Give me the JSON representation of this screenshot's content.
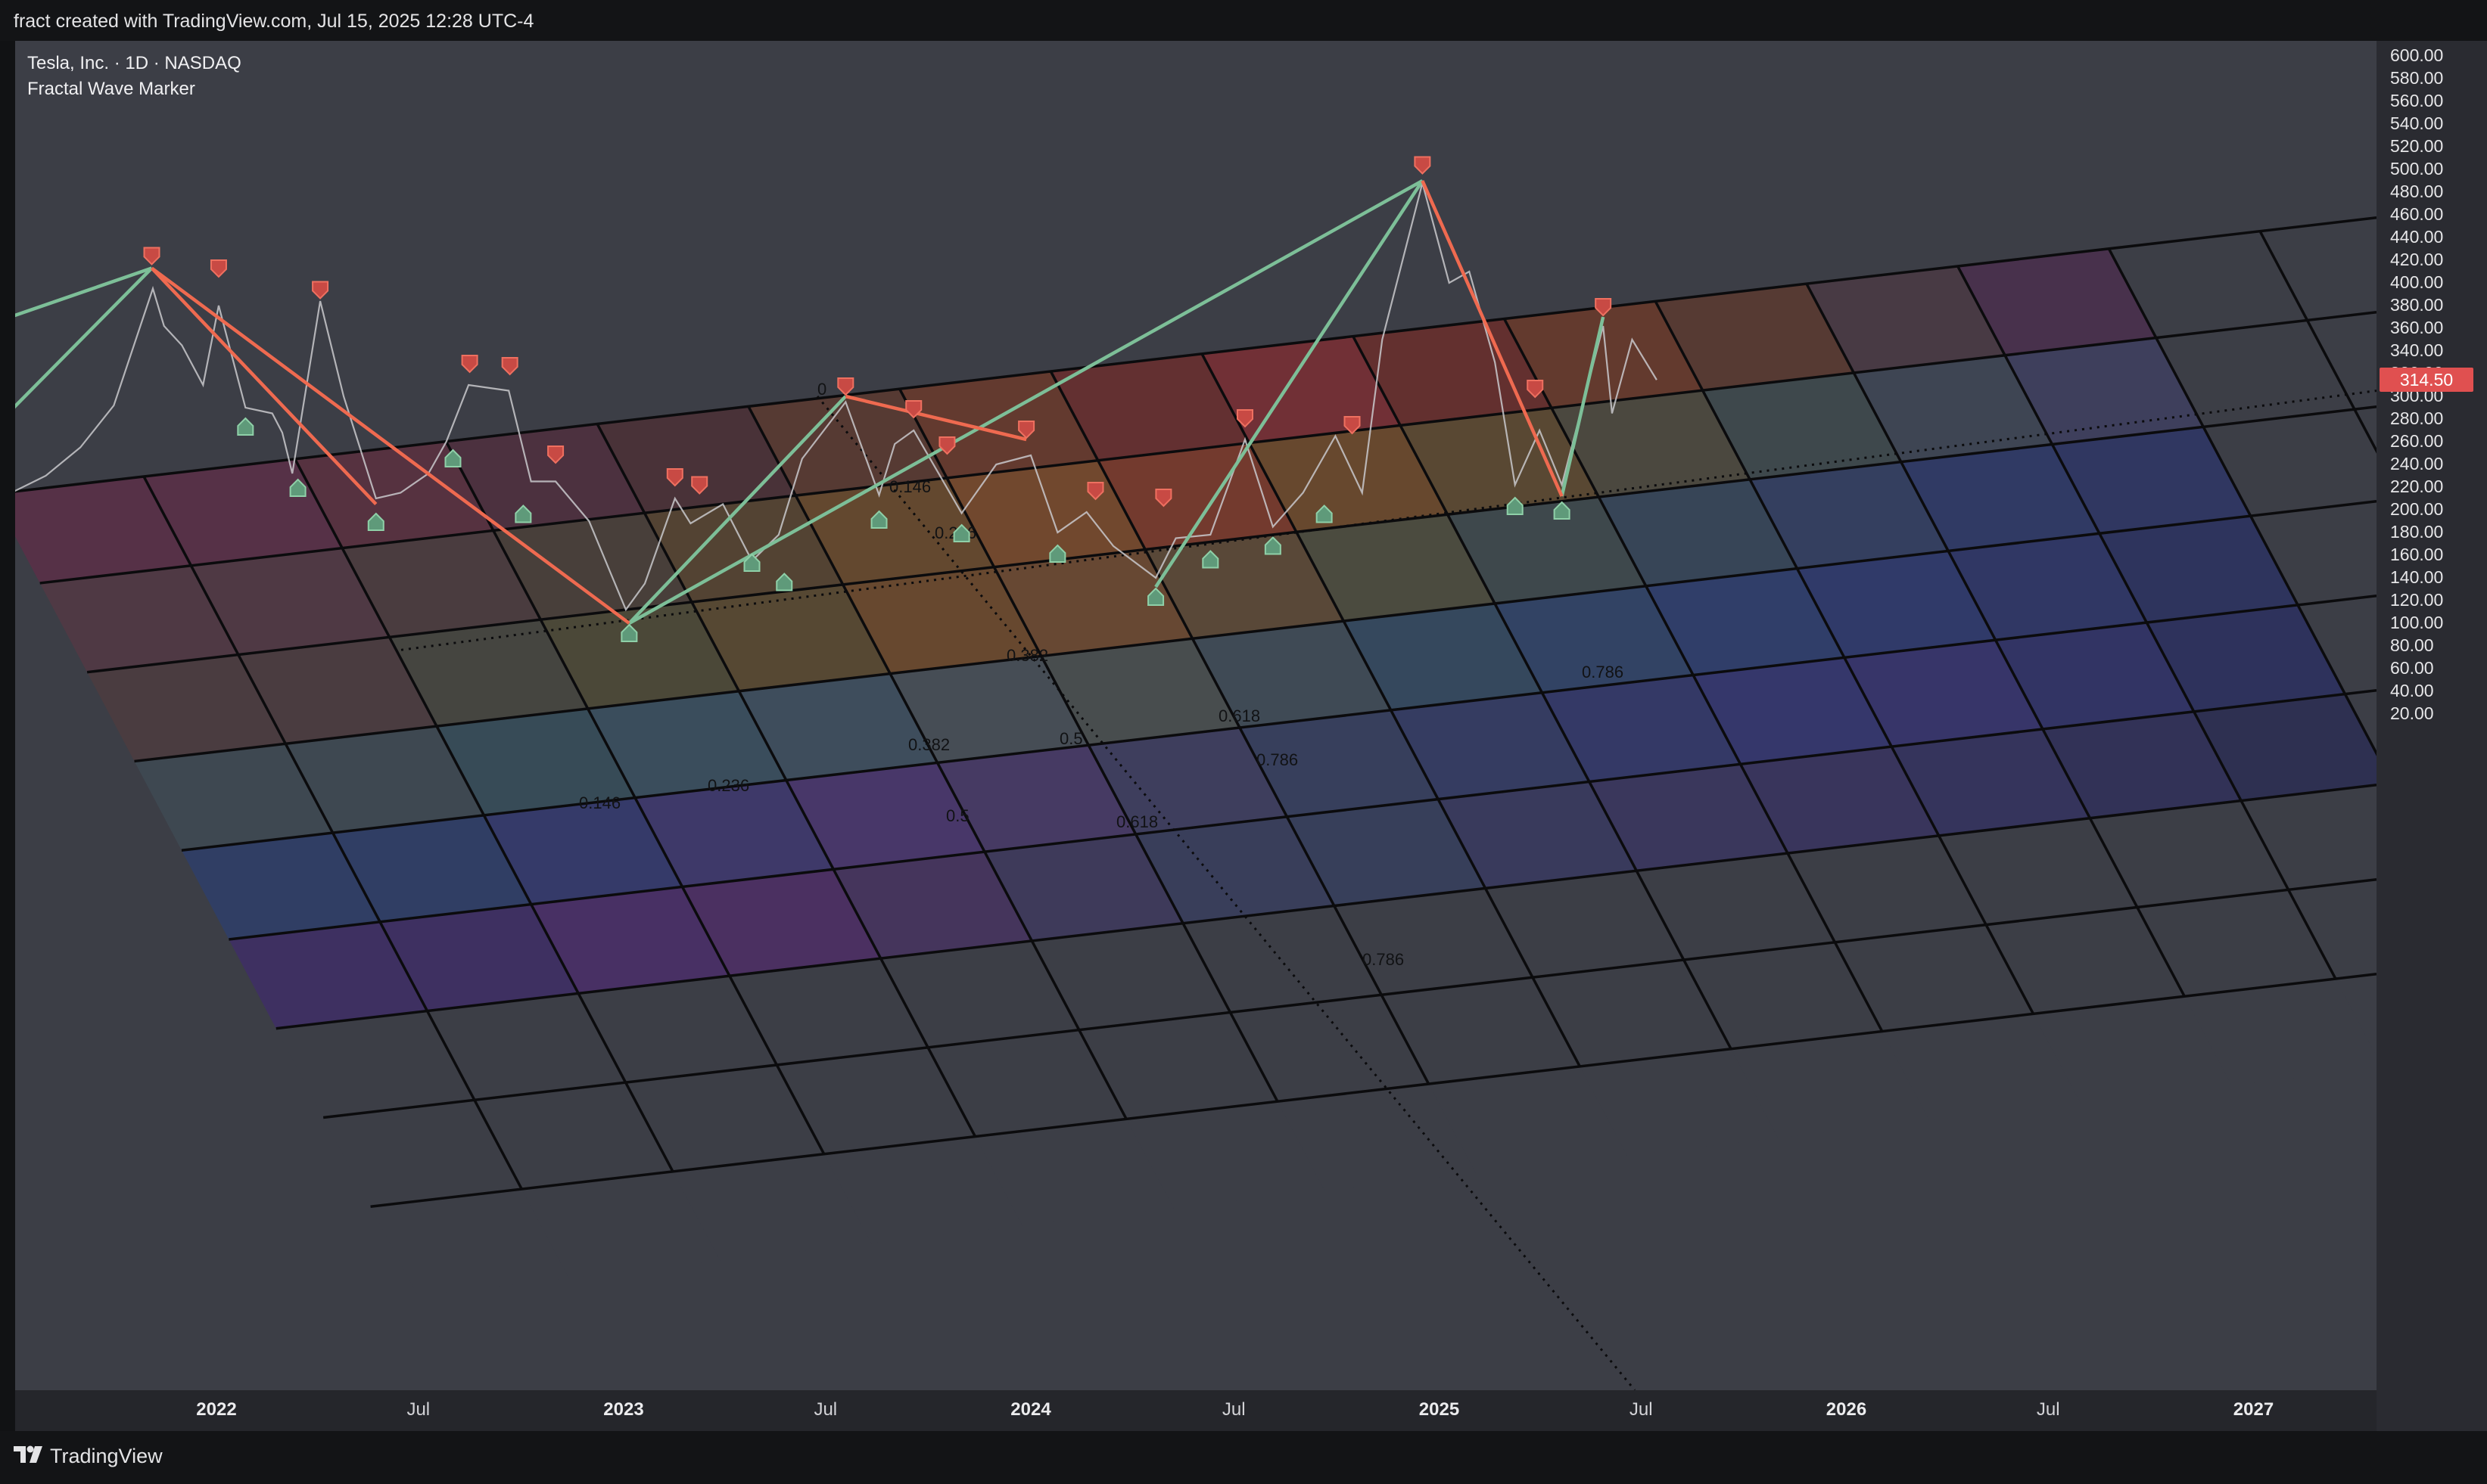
{
  "header": {
    "text": "fract created with TradingView.com, Jul 15, 2025 12:28 UTC-4"
  },
  "legend": {
    "symbol": "Tesla, Inc. · 1D · NASDAQ",
    "indicator": "Fractal Wave Marker"
  },
  "footer": {
    "brand": "TradingView"
  },
  "colors": {
    "background": "#3c3e46",
    "up_wave": "#7dbf98",
    "down_wave": "#ef6a50",
    "current_price": "#e05050"
  },
  "chart_data": {
    "type": "line",
    "title": "Tesla, Inc. · 1D · NASDAQ",
    "xlabel": "",
    "ylabel": "",
    "ylim": [
      8,
      605
    ],
    "xlim": [
      "2021-06-01",
      "2027-01-01"
    ],
    "y_ticks": [
      "600.00",
      "580.00",
      "560.00",
      "540.00",
      "520.00",
      "500.00",
      "480.00",
      "460.00",
      "440.00",
      "420.00",
      "400.00",
      "380.00",
      "360.00",
      "340.00",
      "320.00",
      "300.00",
      "280.00",
      "260.00",
      "240.00",
      "220.00",
      "200.00",
      "180.00",
      "160.00",
      "140.00",
      "120.00",
      "100.00",
      "80.00",
      "60.00",
      "40.00",
      "20.00"
    ],
    "x_ticks": [
      {
        "label": "2022",
        "x": "2022-01-01",
        "year": true
      },
      {
        "label": "Jul",
        "x": "2022-07-01",
        "year": false
      },
      {
        "label": "2023",
        "x": "2023-01-01",
        "year": true
      },
      {
        "label": "Jul",
        "x": "2023-07-01",
        "year": false
      },
      {
        "label": "2024",
        "x": "2024-01-01",
        "year": true
      },
      {
        "label": "Jul",
        "x": "2024-07-01",
        "year": false
      },
      {
        "label": "2025",
        "x": "2025-01-01",
        "year": true
      },
      {
        "label": "Jul",
        "x": "2025-07-01",
        "year": false
      },
      {
        "label": "2026",
        "x": "2026-01-01",
        "year": true
      },
      {
        "label": "Jul",
        "x": "2026-07-01",
        "year": false
      },
      {
        "label": "2027",
        "x": "2027-01-01",
        "year": true
      }
    ],
    "current_price": 314.5,
    "current_price_label": "314.50",
    "series": [
      {
        "name": "",
        "points": [
          [
            "2021-06-01",
            208
          ],
          [
            "2021-07-01",
            215
          ],
          [
            "2021-08-01",
            230
          ],
          [
            "2021-09-01",
            255
          ],
          [
            "2021-10-01",
            292
          ],
          [
            "2021-11-05",
            395
          ],
          [
            "2021-11-15",
            362
          ],
          [
            "2021-12-01",
            345
          ],
          [
            "2021-12-20",
            310
          ],
          [
            "2022-01-03",
            380
          ],
          [
            "2022-01-27",
            290
          ],
          [
            "2022-02-20",
            285
          ],
          [
            "2022-03-01",
            268
          ],
          [
            "2022-03-10",
            232
          ],
          [
            "2022-04-04",
            384
          ],
          [
            "2022-04-25",
            300
          ],
          [
            "2022-05-24",
            210
          ],
          [
            "2022-06-15",
            215
          ],
          [
            "2022-07-10",
            232
          ],
          [
            "2022-07-26",
            260
          ],
          [
            "2022-08-15",
            310
          ],
          [
            "2022-09-20",
            305
          ],
          [
            "2022-10-10",
            225
          ],
          [
            "2022-11-01",
            225
          ],
          [
            "2022-12-01",
            190
          ],
          [
            "2022-12-20",
            145
          ],
          [
            "2023-01-03",
            112
          ],
          [
            "2023-01-20",
            135
          ],
          [
            "2023-02-16",
            210
          ],
          [
            "2023-03-02",
            188
          ],
          [
            "2023-03-31",
            205
          ],
          [
            "2023-04-26",
            155
          ],
          [
            "2023-05-20",
            178
          ],
          [
            "2023-06-10",
            245
          ],
          [
            "2023-07-19",
            295
          ],
          [
            "2023-08-18",
            213
          ],
          [
            "2023-09-01",
            258
          ],
          [
            "2023-09-18",
            270
          ],
          [
            "2023-10-31",
            197
          ],
          [
            "2023-12-01",
            240
          ],
          [
            "2024-01-01",
            248
          ],
          [
            "2024-01-25",
            180
          ],
          [
            "2024-02-20",
            198
          ],
          [
            "2024-03-15",
            168
          ],
          [
            "2024-04-22",
            140
          ],
          [
            "2024-05-10",
            175
          ],
          [
            "2024-06-10",
            178
          ],
          [
            "2024-07-11",
            262
          ],
          [
            "2024-08-05",
            185
          ],
          [
            "2024-09-01",
            215
          ],
          [
            "2024-09-30",
            265
          ],
          [
            "2024-10-24",
            215
          ],
          [
            "2024-11-11",
            350
          ],
          [
            "2024-12-17",
            488
          ],
          [
            "2025-01-10",
            400
          ],
          [
            "2025-01-28",
            410
          ],
          [
            "2025-02-20",
            330
          ],
          [
            "2025-03-10",
            222
          ],
          [
            "2025-04-01",
            270
          ],
          [
            "2025-04-21",
            222
          ],
          [
            "2025-05-28",
            362
          ],
          [
            "2025-06-05",
            285
          ],
          [
            "2025-06-23",
            350
          ],
          [
            "2025-07-15",
            314.5
          ]
        ]
      },
      {
        "name": "",
        "fractal_highs": [
          [
            "2021-11-04",
            415
          ],
          [
            "2022-01-03",
            404
          ],
          [
            "2022-04-04",
            385
          ],
          [
            "2022-08-16",
            320
          ],
          [
            "2022-09-21",
            318
          ],
          [
            "2022-11-01",
            240
          ],
          [
            "2023-02-16",
            220
          ],
          [
            "2023-03-10",
            213
          ],
          [
            "2023-07-19",
            300
          ],
          [
            "2023-09-18",
            280
          ],
          [
            "2023-10-18",
            248
          ],
          [
            "2023-12-28",
            262
          ],
          [
            "2024-02-28",
            208
          ],
          [
            "2024-04-29",
            202
          ],
          [
            "2024-07-11",
            272
          ],
          [
            "2024-10-15",
            266
          ],
          [
            "2024-12-17",
            495
          ],
          [
            "2025-03-28",
            298
          ],
          [
            "2025-05-28",
            370
          ]
        ],
        "fractal_lows": [
          [
            "2022-01-27",
            282
          ],
          [
            "2022-03-15",
            228
          ],
          [
            "2022-05-24",
            198
          ],
          [
            "2022-08-01",
            254
          ],
          [
            "2022-10-03",
            205
          ],
          [
            "2023-01-06",
            100
          ],
          [
            "2023-04-26",
            162
          ],
          [
            "2023-05-25",
            145
          ],
          [
            "2023-08-18",
            200
          ],
          [
            "2023-10-31",
            188
          ],
          [
            "2024-01-25",
            170
          ],
          [
            "2024-04-22",
            132
          ],
          [
            "2024-06-10",
            165
          ],
          [
            "2024-08-05",
            177
          ],
          [
            "2024-09-20",
            205
          ],
          [
            "2025-03-10",
            212
          ],
          [
            "2025-04-21",
            208
          ]
        ]
      }
    ],
    "waves": {
      "up": [
        [
          [
            "2021-06-01",
            360
          ],
          [
            "2021-11-04",
            413
          ]
        ],
        [
          [
            "2021-06-01",
            258
          ],
          [
            "2021-11-04",
            413
          ]
        ],
        [
          [
            "2023-01-06",
            100
          ],
          [
            "2023-07-19",
            300
          ]
        ],
        [
          [
            "2023-01-06",
            100
          ],
          [
            "2024-12-17",
            490
          ]
        ],
        [
          [
            "2024-04-22",
            132
          ],
          [
            "2024-12-17",
            490
          ]
        ],
        [
          [
            "2025-04-21",
            212
          ],
          [
            "2025-05-28",
            370
          ]
        ]
      ],
      "down": [
        [
          [
            "2021-11-04",
            413
          ],
          [
            "2023-01-06",
            100
          ]
        ],
        [
          [
            "2021-11-04",
            413
          ],
          [
            "2022-05-24",
            205
          ]
        ],
        [
          [
            "2023-07-19",
            300
          ],
          [
            "2023-12-28",
            262
          ]
        ],
        [
          [
            "2024-12-17",
            490
          ],
          [
            "2025-04-21",
            212
          ]
        ]
      ]
    },
    "grid_levels": [
      "0",
      "0.146",
      "0.236",
      "0.382",
      "0.5",
      "0.618",
      "0.786"
    ],
    "grid_levels_lower": [
      "0.146",
      "0.236",
      "0.382",
      "0.5",
      "0.618",
      "0.786",
      "0.786"
    ]
  }
}
